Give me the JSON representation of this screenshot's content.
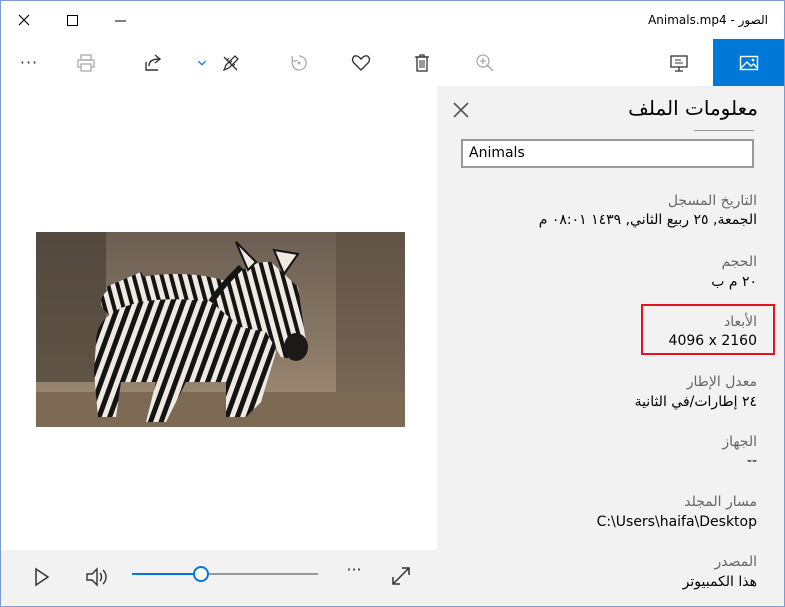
{
  "window": {
    "title": "الصور - Animals.mp4"
  },
  "toolbar": {
    "items": [
      {
        "name": "more-options",
        "icon": "ellipsis-icon"
      },
      {
        "name": "print",
        "icon": "print-icon"
      },
      {
        "name": "share",
        "icon": "share-icon"
      },
      {
        "name": "edit-create",
        "icon": "chevron-down-icon"
      },
      {
        "name": "draw",
        "icon": "pen-ruler-icon"
      },
      {
        "name": "rotate",
        "icon": "rotate-icon"
      },
      {
        "name": "favorite",
        "icon": "heart-icon"
      },
      {
        "name": "delete",
        "icon": "trash-icon"
      },
      {
        "name": "zoom",
        "icon": "zoom-in-icon"
      },
      {
        "name": "slideshow",
        "icon": "slideshow-icon"
      },
      {
        "name": "file-info",
        "icon": "image-icon"
      }
    ],
    "more_glyph": "···"
  },
  "player": {
    "progress": 0.37,
    "more_glyph": "···"
  },
  "panel": {
    "title": "معلومات الملف",
    "name_value": "Animals",
    "fields": [
      {
        "label": "التاريخ المسجل",
        "value": "الجمعة, ٢٥ ربيع الثاني, ١٤٣٩ ‏٠٨:٠١ م"
      },
      {
        "label": "الحجم",
        "value": "٢٠ م ب"
      },
      {
        "label": "الأبعاد",
        "value": "4096 x 2160"
      },
      {
        "label": "معدل الإطار",
        "value": "٢٤ إطارات/في الثانية"
      },
      {
        "label": "الجهاز",
        "value": "--"
      },
      {
        "label": "مسار المجلد",
        "value": "C:\\Users\\haifa\\Desktop"
      },
      {
        "label": "المصدر",
        "value": "هذا الكمبيوتر"
      }
    ]
  },
  "colors": {
    "accent": "#0078d7",
    "highlight": "#e81123",
    "panel_bg": "#f2f2f2"
  }
}
